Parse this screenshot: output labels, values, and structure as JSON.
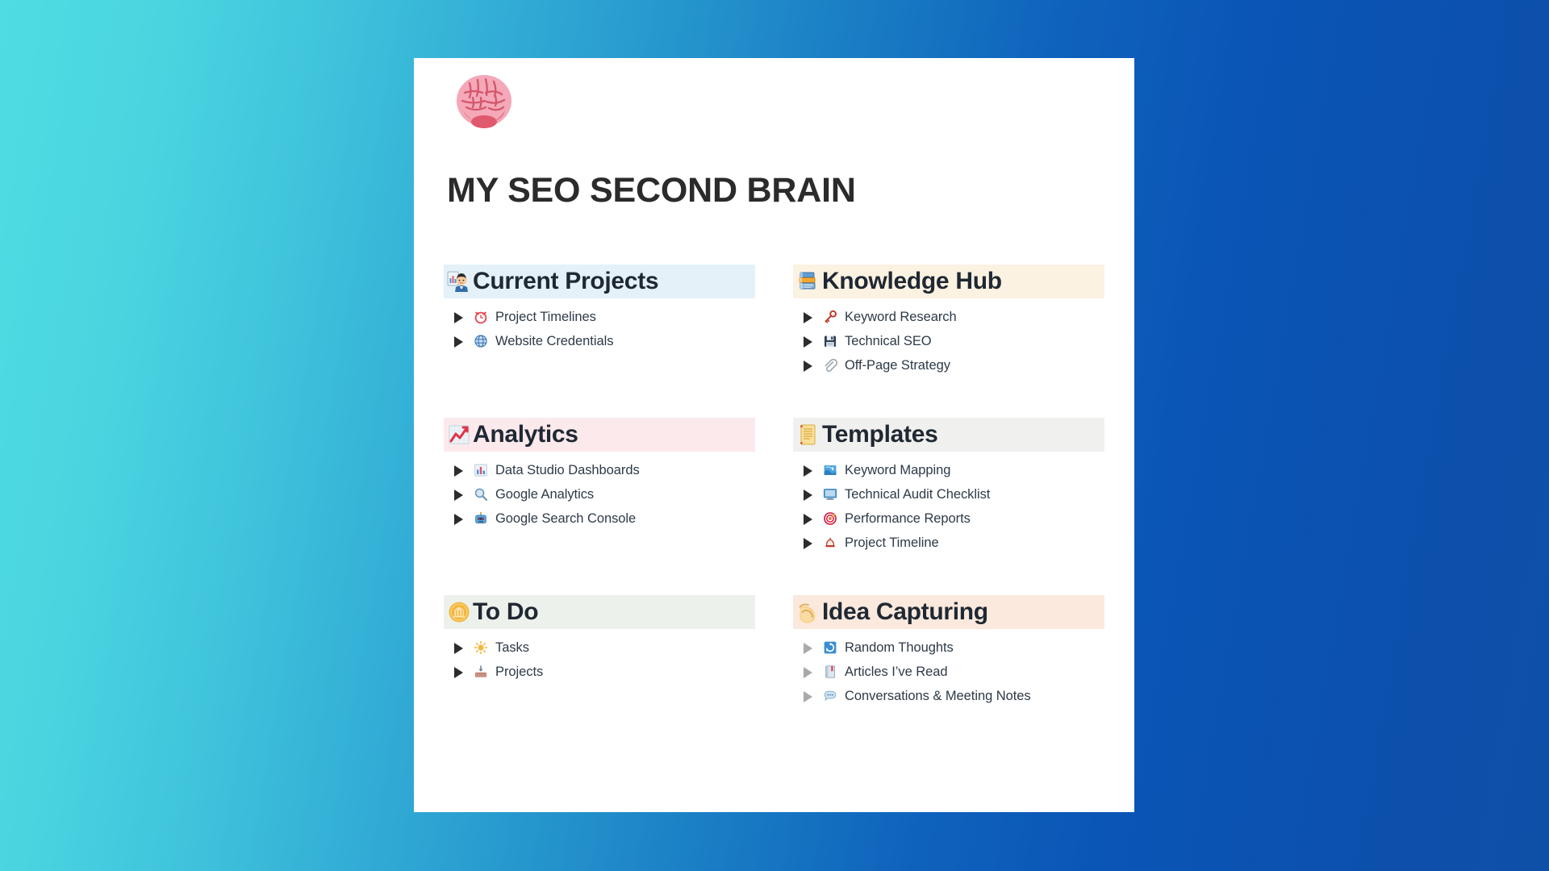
{
  "background": {
    "gradient_from": "#4FDDE2",
    "gradient_to": "#0E4FA8"
  },
  "card": {
    "logo_icon": "brain-emoji",
    "title": "MY SEO SECOND BRAIN"
  },
  "sections": [
    {
      "id": "current-projects",
      "title": "Current Projects",
      "emoji": "man-office-worker-emoji",
      "accent": "#e4f1f9",
      "toggle_style": "dark",
      "items": [
        {
          "label": "Project Timelines",
          "emoji": "alarm-clock-emoji"
        },
        {
          "label": "Website Credentials",
          "emoji": "globe-emoji"
        }
      ]
    },
    {
      "id": "knowledge-hub",
      "title": "Knowledge Hub",
      "emoji": "books-emoji",
      "accent": "#fcf2e2",
      "toggle_style": "dark",
      "items": [
        {
          "label": "Keyword Research",
          "emoji": "key-emoji"
        },
        {
          "label": "Technical SEO",
          "emoji": "floppy-disk-emoji"
        },
        {
          "label": "Off-Page Strategy",
          "emoji": "paperclip-emoji"
        }
      ]
    },
    {
      "id": "analytics",
      "title": "Analytics",
      "emoji": "chart-increasing-emoji",
      "accent": "#fce9ec",
      "toggle_style": "dark",
      "items": [
        {
          "label": "Data Studio Dashboards",
          "emoji": "bar-chart-emoji"
        },
        {
          "label": "Google Analytics",
          "emoji": "magnifying-glass-emoji"
        },
        {
          "label": "Google Search Console",
          "emoji": "robot-emoji"
        }
      ]
    },
    {
      "id": "templates",
      "title": "Templates",
      "emoji": "scroll-emoji",
      "accent": "#f0f0ee",
      "toggle_style": "dark",
      "items": [
        {
          "label": "Keyword Mapping",
          "emoji": "map-emoji"
        },
        {
          "label": "Technical Audit Checklist",
          "emoji": "desktop-computer-emoji"
        },
        {
          "label": "Performance Reports",
          "emoji": "direct-hit-emoji"
        },
        {
          "label": "Project Timeline",
          "emoji": "bell-emoji"
        }
      ]
    },
    {
      "id": "to-do",
      "title": "To Do",
      "emoji": "coin-emoji",
      "accent": "#ecf1eb",
      "toggle_style": "dark",
      "items": [
        {
          "label": "Tasks",
          "emoji": "sun-emoji"
        },
        {
          "label": "Projects",
          "emoji": "inbox-tray-emoji"
        }
      ]
    },
    {
      "id": "idea-capturing",
      "title": "Idea Capturing",
      "emoji": "flexed-biceps-emoji",
      "accent": "#fbe9dd",
      "toggle_style": "light",
      "items": [
        {
          "label": "Random Thoughts",
          "emoji": "recycle-square-emoji"
        },
        {
          "label": "Articles I’ve Read",
          "emoji": "closed-book-emoji"
        },
        {
          "label": "Conversations & Meeting Notes",
          "emoji": "speech-balloon-emoji"
        }
      ]
    }
  ]
}
